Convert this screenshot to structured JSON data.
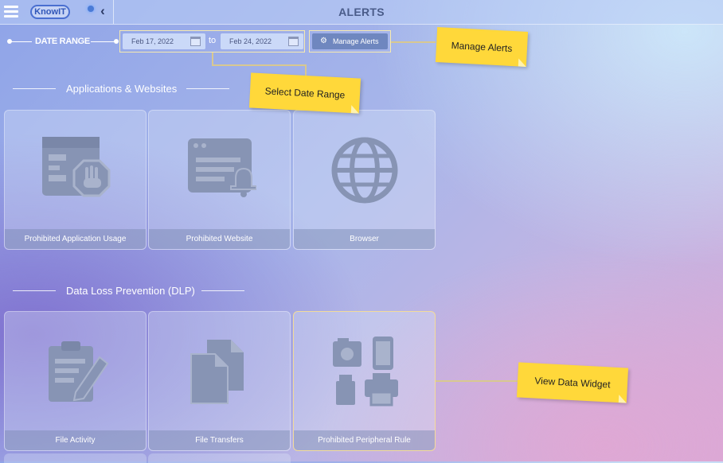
{
  "header": {
    "logo_text": "KnowIT",
    "title": "ALERTS"
  },
  "filters": {
    "date_range_label": "DATE RANGE",
    "start_date": "Feb 17, 2022",
    "to_label": "to",
    "end_date": "Feb 24, 2022",
    "manage_alerts_label": "Manage Alerts"
  },
  "sections": [
    {
      "title": "Applications & Websites",
      "tiles": [
        {
          "label": "Prohibited Application Usage",
          "icon": "app-block-icon"
        },
        {
          "label": "Prohibited Website",
          "icon": "website-alert-icon"
        },
        {
          "label": "Browser",
          "icon": "globe-icon"
        }
      ]
    },
    {
      "title": "Data Loss Prevention (DLP)",
      "tiles": [
        {
          "label": "File Activity",
          "icon": "file-edit-icon"
        },
        {
          "label": "File Transfers",
          "icon": "files-copy-icon"
        },
        {
          "label": "Prohibited Peripheral Rule",
          "icon": "peripherals-icon"
        }
      ]
    }
  ],
  "annotations": {
    "manage_alerts": "Manage Alerts",
    "select_date_range": "Select Date Range",
    "view_data_widget": "View Data Widget"
  },
  "colors": {
    "accent": "#6f87bf",
    "sticky_note": "#ffd83a",
    "icon_fill": "#8794b4"
  }
}
